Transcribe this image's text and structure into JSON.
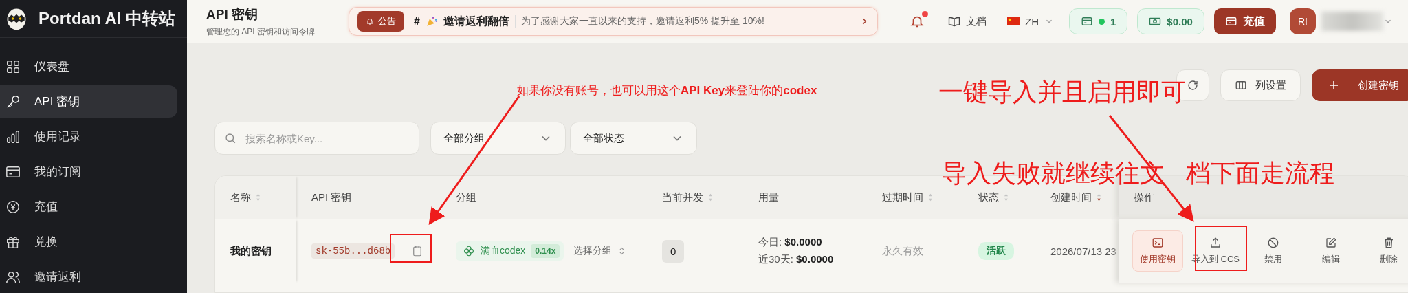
{
  "brand": {
    "name": "Portdan AI 中转站"
  },
  "sidebar": {
    "items": [
      {
        "label": "仪表盘",
        "selected": false
      },
      {
        "label": "API 密钥",
        "selected": true
      },
      {
        "label": "使用记录",
        "selected": false
      },
      {
        "label": "我的订阅",
        "selected": false
      },
      {
        "label": "充值",
        "selected": false
      },
      {
        "label": "兑换",
        "selected": false
      },
      {
        "label": "邀请返利",
        "selected": false
      }
    ]
  },
  "header": {
    "title": "API 密钥",
    "subtitle": "管理您的 API 密钥和访问令牌"
  },
  "announcement": {
    "badge": "公告",
    "tag": "#",
    "title": "邀请返利翻倍",
    "text": "为了感谢大家一直以来的支持，邀请返利5% 提升至 10%!"
  },
  "topbar": {
    "unread": true,
    "docs": "文档",
    "language": "ZH",
    "subscriptions": "1",
    "balance": "$0.00",
    "recharge": "充值",
    "avatar": "RI"
  },
  "toolbar": {
    "columns": "列设置",
    "create": "创建密钥"
  },
  "filters": {
    "search_placeholder": "搜索名称或Key...",
    "group": "全部分组",
    "status": "全部状态"
  },
  "table": {
    "columns": [
      {
        "label": "名称",
        "sortable": true,
        "descending": false
      },
      {
        "label": "API 密钥",
        "sortable": false,
        "descending": false
      },
      {
        "label": "分组",
        "sortable": false,
        "descending": false
      },
      {
        "label": "当前并发",
        "sortable": true,
        "descending": false
      },
      {
        "label": "用量",
        "sortable": false,
        "descending": false
      },
      {
        "label": "过期时间",
        "sortable": true,
        "descending": false
      },
      {
        "label": "状态",
        "sortable": true,
        "descending": false
      },
      {
        "label": "创建时间",
        "sortable": true,
        "descending": true
      },
      {
        "label": "操作",
        "sortable": false,
        "descending": false
      }
    ],
    "rows": [
      {
        "name": "我的密钥",
        "key": "sk-55b...d68b",
        "group": "满血codex",
        "ratio": "0.14x",
        "group_select": "选择分组",
        "concurrency": "0",
        "today_label": "今日:",
        "today": "$0.0000",
        "month_label": "近30天:",
        "month": "$0.0000",
        "expires": "永久有效",
        "status": "活跃",
        "created": "2026/07/13 23",
        "actions": [
          {
            "kind": "terminal",
            "label": "使用密钥",
            "highlighted": true
          },
          {
            "kind": "upload",
            "label": "导入到 CCS",
            "highlighted": false
          },
          {
            "kind": "ban",
            "label": "禁用",
            "highlighted": false
          },
          {
            "kind": "edit",
            "label": "编辑",
            "highlighted": false
          },
          {
            "kind": "trash",
            "label": "删除",
            "highlighted": false
          }
        ]
      }
    ]
  },
  "annotations": [
    {
      "kind": "note",
      "text": "如果你没有账号，也可以用这个**API Key**来登陆你的**codex**"
    },
    {
      "kind": "heading",
      "text": "一键导入并且启用即可"
    },
    {
      "kind": "heading",
      "text": "导入失败就继续往文"
    },
    {
      "kind": "heading",
      "text": "档下面走流程"
    }
  ]
}
